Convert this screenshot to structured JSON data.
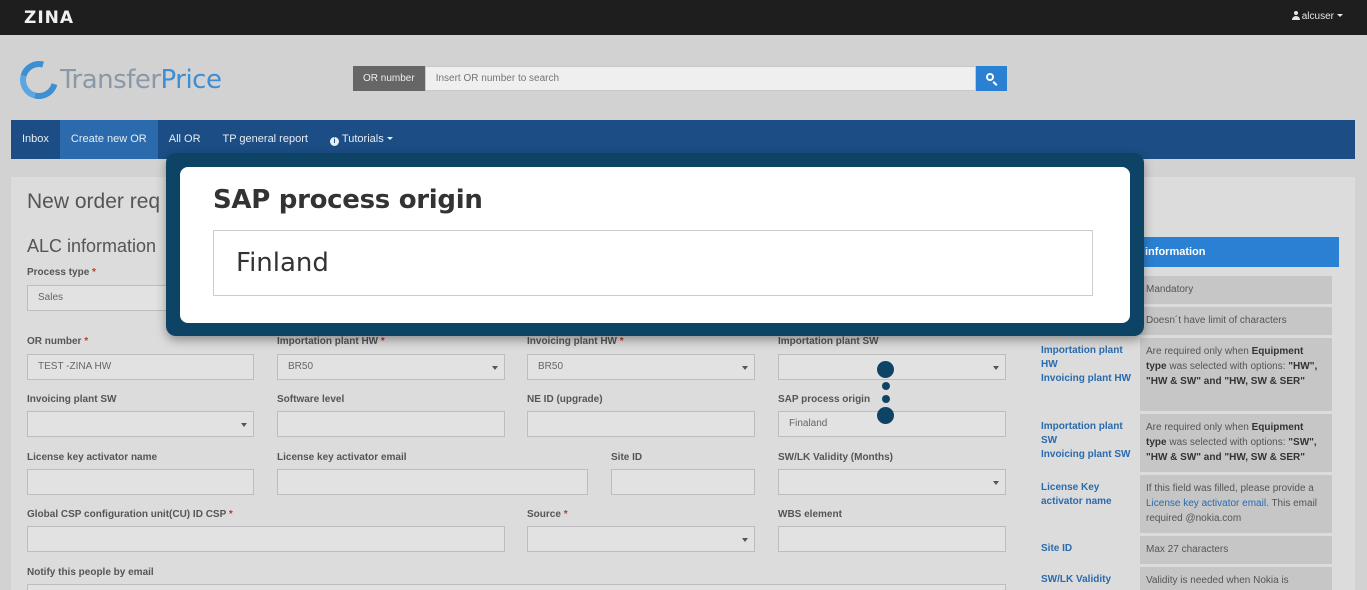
{
  "topbar": {
    "brand": "ZINA",
    "user": "alcuser"
  },
  "logo": {
    "part1": "Transfer",
    "part2": "Price"
  },
  "search": {
    "label": "OR number",
    "placeholder": "Insert OR number to search"
  },
  "nav": {
    "items": [
      "Inbox",
      "Create new OR",
      "All OR",
      "TP general report",
      "Tutorials"
    ]
  },
  "page": {
    "title": "New order req",
    "section": "ALC information"
  },
  "form": {
    "process_type": {
      "label": "Process type",
      "value": "Sales"
    },
    "or_number": {
      "label": "OR number",
      "value": "TEST -ZINA HW"
    },
    "importation_plant_hw": {
      "label": "Importation plant HW",
      "value": "BR50"
    },
    "invoicing_plant_hw": {
      "label": "Invoicing plant HW",
      "value": "BR50"
    },
    "importation_plant_sw": {
      "label": "Importation plant SW",
      "value": ""
    },
    "invoicing_plant_sw": {
      "label": "Invoicing plant SW",
      "value": ""
    },
    "software_level": {
      "label": "Software level",
      "value": ""
    },
    "ne_id": {
      "label": "NE ID (upgrade)",
      "value": ""
    },
    "sap_process_origin": {
      "label": "SAP process origin",
      "value": "Finaland"
    },
    "license_key_name": {
      "label": "License key activator name",
      "value": ""
    },
    "license_key_email": {
      "label": "License key activator email",
      "value": ""
    },
    "site_id": {
      "label": "Site ID",
      "value": ""
    },
    "sw_lk_validity": {
      "label": "SW/LK Validity (Months)",
      "value": ""
    },
    "global_csp": {
      "label": "Global CSP configuration unit(CU) ID CSP",
      "value": ""
    },
    "source": {
      "label": "Source",
      "value": ""
    },
    "wbs": {
      "label": "WBS element",
      "value": ""
    },
    "notify": {
      "label": "Notify this people by email"
    }
  },
  "side": {
    "header": "information",
    "rows": [
      {
        "left": "",
        "right": "Mandatory"
      },
      {
        "left": "",
        "right": "Doesn´t have limit of characters"
      },
      {
        "left": "Importation plant HW\nInvoicing plant HW",
        "right_pre": "Are required only when ",
        "right_bold": "Equipment type",
        "right_mid": " was selected with options: ",
        "right_opts": "\"HW\", \"HW & SW\" and \"HW, SW & SER\""
      },
      {
        "left": "Importation plant SW\nInvoicing plant SW",
        "right_pre": "Are required only when ",
        "right_bold": "Equipment type",
        "right_mid": " was selected with options: ",
        "right_opts": "\"SW\", \"HW & SW\" and \"HW, SW & SER\""
      },
      {
        "left": "License Key activator name",
        "right_pre": "If this field was filled, please provide a ",
        "right_link": "License key activator email.",
        "right_post": " This email required @nokia.com"
      },
      {
        "left": "Site ID",
        "right": "Max 27 characters"
      },
      {
        "left": "SW/LK Validity",
        "right": "Validity is needed when Nokia is"
      }
    ]
  },
  "callout": {
    "label": "SAP process origin",
    "value": "Finland"
  },
  "colors": {
    "navbar": "#1c4d84",
    "accent": "#2a80d2",
    "callout_frame": "#0d4466"
  }
}
